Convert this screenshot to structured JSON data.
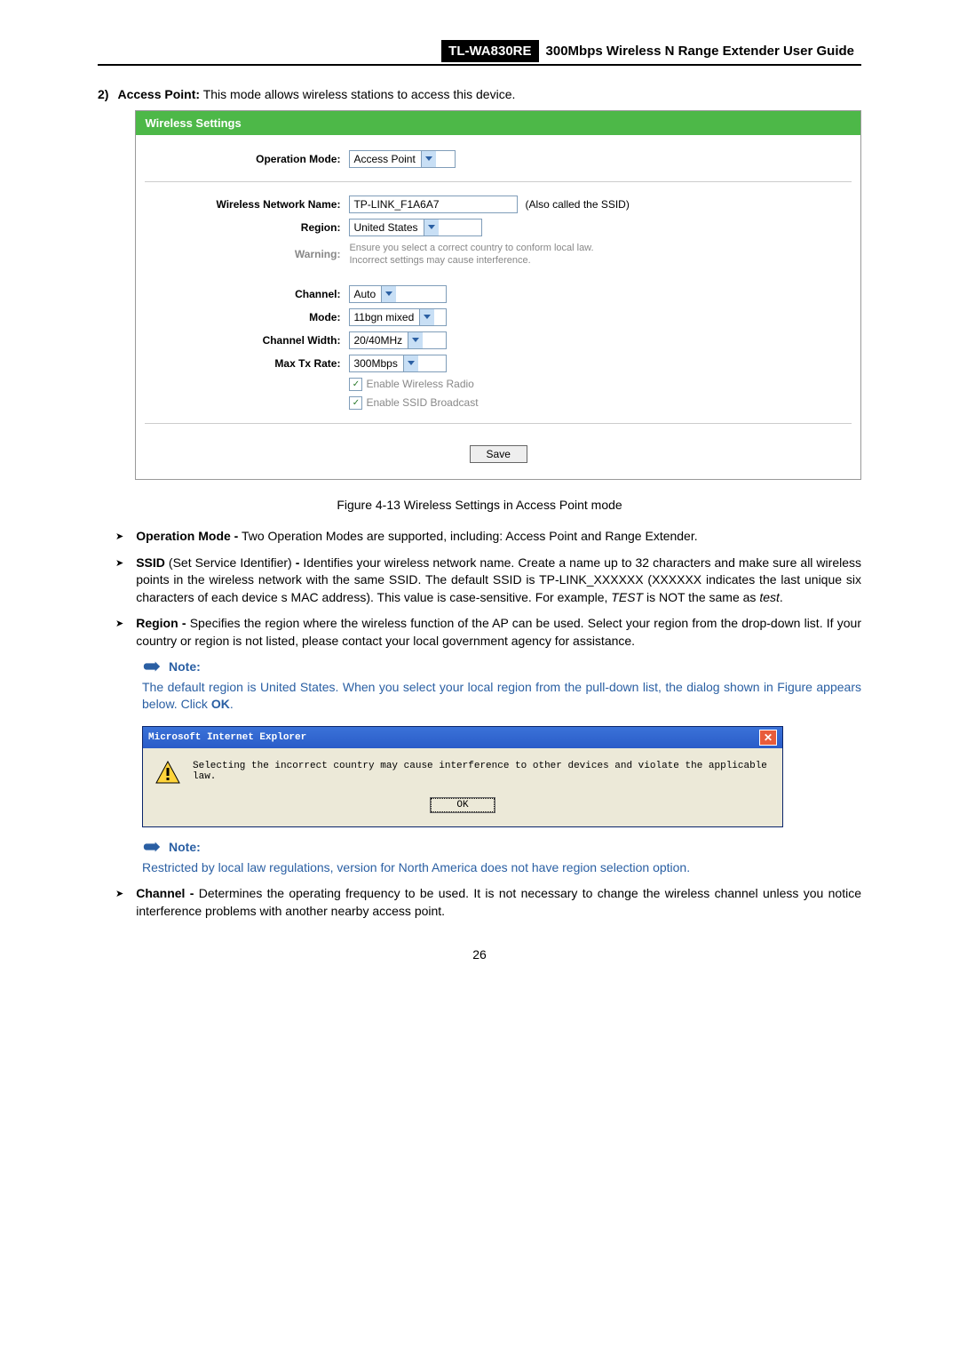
{
  "header": {
    "model": "TL-WA830RE",
    "title": "300Mbps Wireless N Range Extender User Guide"
  },
  "item2": {
    "num": "2)",
    "label": "Access Point:",
    "text": "This mode allows wireless stations to access this device."
  },
  "panel": {
    "title": "Wireless Settings",
    "op_mode_label": "Operation Mode:",
    "op_mode_value": "Access Point",
    "ssid_label": "Wireless Network Name:",
    "ssid_value": "TP-LINK_F1A6A7",
    "ssid_hint": "(Also called the SSID)",
    "region_label": "Region:",
    "region_value": "United States",
    "warning_label": "Warning:",
    "warning_line1": "Ensure you select a correct country to conform local law.",
    "warning_line2": "Incorrect settings may cause interference.",
    "channel_label": "Channel:",
    "channel_value": "Auto",
    "mode_label": "Mode:",
    "mode_value": "11bgn mixed",
    "cw_label": "Channel Width:",
    "cw_value": "20/40MHz",
    "rate_label": "Max Tx Rate:",
    "rate_value": "300Mbps",
    "chk1": "Enable Wireless Radio",
    "chk2": "Enable SSID Broadcast",
    "save": "Save"
  },
  "fig_caption": "Figure 4-13 Wireless Settings in Access Point mode",
  "bullets": {
    "op_mode_b": "Operation Mode -",
    "op_mode_t": " Two Operation Modes are supported, including: Access Point and Range Extender.",
    "ssid_b": "SSID",
    "ssid_mid": " (Set Service Identifier) ",
    "ssid_dash": "-",
    "ssid_t1": " Identifies your wireless network name. Create a name up to 32 characters and make sure all wireless points in the wireless network with the same SSID. The default SSID is TP-LINK_XXXXXX (XXXXXX indicates the last unique six characters of each device s MAC address). This value is case-sensitive. For example, ",
    "ssid_em1": "TEST",
    "ssid_t2": " is NOT the same as ",
    "ssid_em2": "test",
    "ssid_t3": ".",
    "region_b": "Region -",
    "region_t": " Specifies the region where the wireless function of the AP can be used. Select your region from the drop-down list. If your country or region is not listed, please contact your local government agency for assistance.",
    "channel_b": "Channel -",
    "channel_t": " Determines the operating frequency to be used. It is not necessary to change the wireless channel unless you notice interference problems with another nearby access point."
  },
  "note_label": "Note:",
  "note1_t1": "The default region is United States. When you select your local region from the pull-down list, the dialog shown in Figure appears below. Click ",
  "note1_ok": "OK",
  "note1_t2": ".",
  "dialog": {
    "title": "Microsoft Internet Explorer",
    "msg": "Selecting the incorrect country may cause interference to other devices and violate the applicable law.",
    "ok": "OK"
  },
  "note2": "Restricted by local law regulations, version for North America does not have region selection option.",
  "page_num": "26"
}
